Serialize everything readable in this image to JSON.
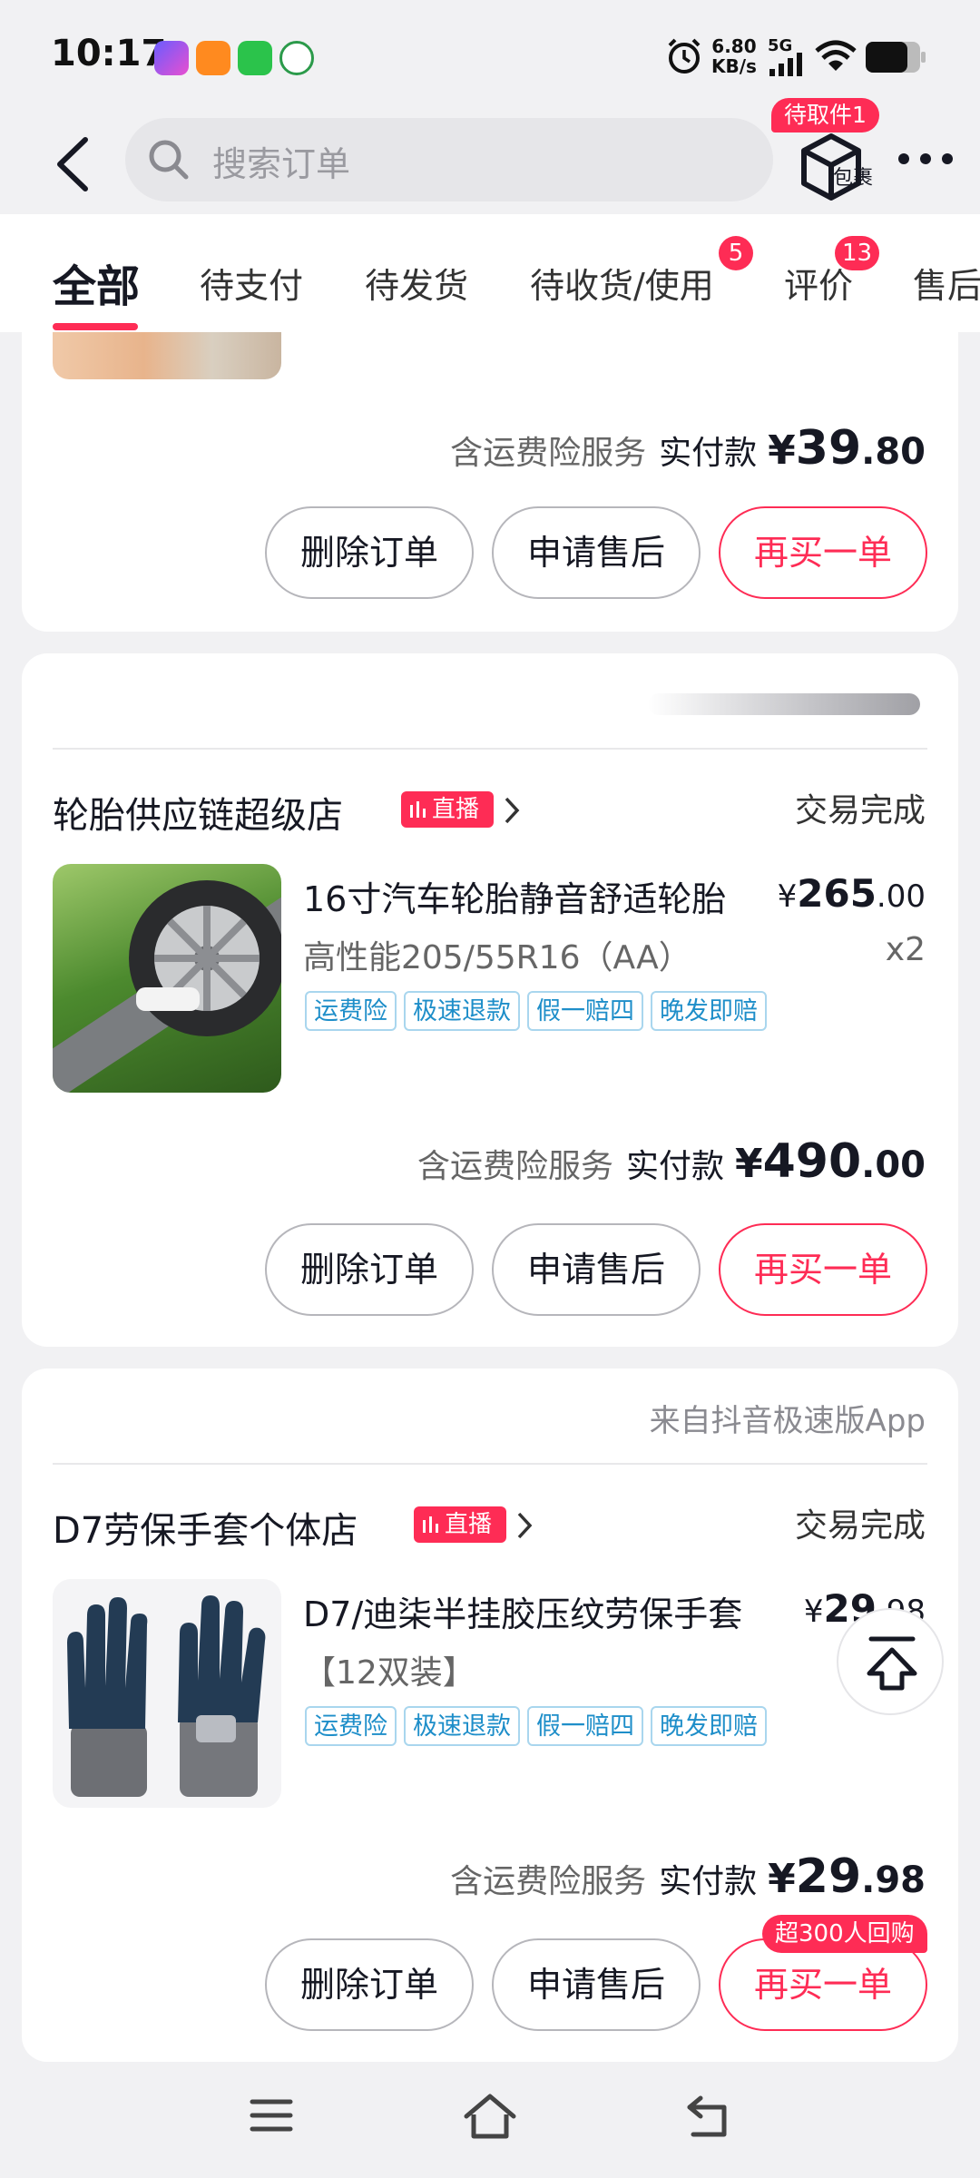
{
  "status_bar": {
    "time": "10:17",
    "net_speed_value": "6.80",
    "net_speed_unit": "KB/s",
    "network": "5G"
  },
  "header": {
    "search_placeholder": "搜索订单",
    "package_badge": "待取件1",
    "package_label": "包裹"
  },
  "tabs": [
    {
      "label": "全部",
      "active": true
    },
    {
      "label": "待支付"
    },
    {
      "label": "待发货"
    },
    {
      "label": "待收货/使用",
      "badge": "5"
    },
    {
      "label": "评价",
      "badge": "13"
    },
    {
      "label": "售后"
    }
  ],
  "orders": [
    {
      "total_label": "含运费险服务",
      "paid_label": "实付款",
      "currency": "¥",
      "total_int": "39",
      "total_dec": ".80",
      "buttons": {
        "delete": "删除订单",
        "after_sale": "申请售后",
        "rebuy": "再买一单"
      }
    },
    {
      "shop": "轮胎供应链超级店",
      "live": "直播",
      "status": "交易完成",
      "product": {
        "title": "16寸汽车轮胎静音舒适轮胎",
        "price_currency": "¥",
        "price_int": "265",
        "price_dec": ".00",
        "spec": "高性能205/55R16（AA）",
        "qty": "x2"
      },
      "tags": [
        "运费险",
        "极速退款",
        "假一赔四",
        "晚发即赔"
      ],
      "total_label": "含运费险服务",
      "paid_label": "实付款",
      "currency": "¥",
      "total_int": "490",
      "total_dec": ".00",
      "buttons": {
        "delete": "删除订单",
        "after_sale": "申请售后",
        "rebuy": "再买一单"
      }
    },
    {
      "source": "来自抖音极速版App",
      "shop": "D7劳保手套个体店",
      "live": "直播",
      "status": "交易完成",
      "product": {
        "title": "D7/迪柒半挂胶压纹劳保手套",
        "price_currency": "¥",
        "price_int": "29",
        "price_dec": ".98",
        "spec": "【12双装】"
      },
      "tags": [
        "运费险",
        "极速退款",
        "假一赔四",
        "晚发即赔"
      ],
      "total_label": "含运费险服务",
      "paid_label": "实付款",
      "currency": "¥",
      "total_int": "29",
      "total_dec": ".98",
      "buttons": {
        "delete": "删除订单",
        "after_sale": "申请售后",
        "rebuy": "再买一单"
      },
      "rebuy_badge": "超300人回购"
    }
  ],
  "colors": {
    "accent": "#fe2c55",
    "tag_text": "#1e8ec9",
    "background": "#f1f1f3"
  }
}
